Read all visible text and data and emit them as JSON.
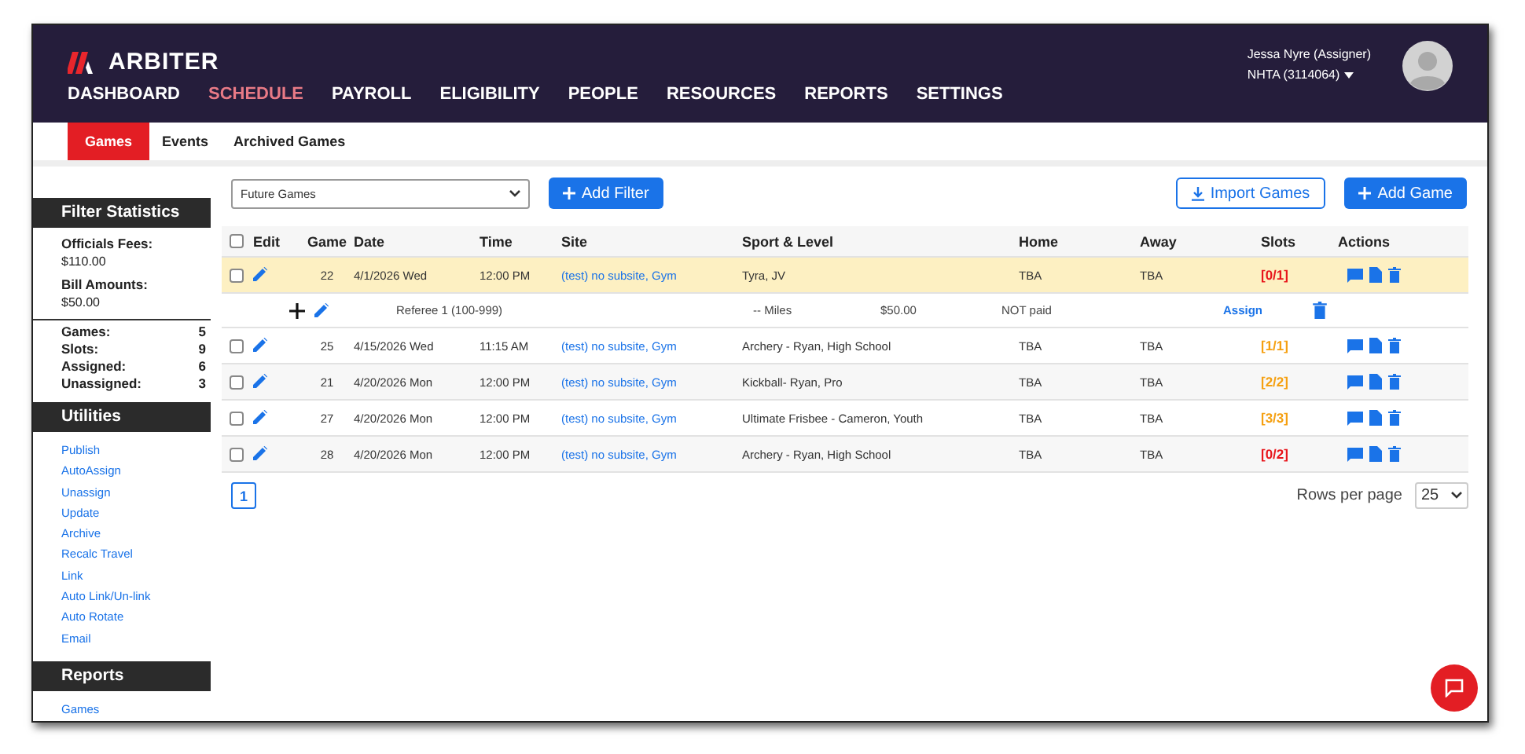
{
  "header": {
    "logo": "ARBITER",
    "nav": [
      {
        "label": "DASHBOARD",
        "selected": false
      },
      {
        "label": "SCHEDULE",
        "selected": true
      },
      {
        "label": "PAYROLL",
        "selected": false
      },
      {
        "label": "ELIGIBILITY",
        "selected": false
      },
      {
        "label": "PEOPLE",
        "selected": false
      },
      {
        "label": "RESOURCES",
        "selected": false
      },
      {
        "label": "REPORTS",
        "selected": false
      },
      {
        "label": "SETTINGS",
        "selected": false
      }
    ],
    "user": "Jessa Nyre (Assigner)",
    "org": "NHTA (3114064)"
  },
  "subtabs": [
    {
      "label": "Games",
      "selected": true
    },
    {
      "label": "Events",
      "selected": false
    },
    {
      "label": "Archived Games",
      "selected": false
    }
  ],
  "sidebar": {
    "filter_title": "Filter Statistics",
    "amounts": [
      {
        "label": "Officials Fees:",
        "value": "$110.00"
      },
      {
        "label": "Bill Amounts:",
        "value": "$50.00"
      }
    ],
    "counts": [
      {
        "label": "Games:",
        "value": "5"
      },
      {
        "label": "Slots:",
        "value": "9"
      },
      {
        "label": "Assigned:",
        "value": "6"
      },
      {
        "label": "Unassigned:",
        "value": "3"
      }
    ],
    "utilities_title": "Utilities",
    "utilities": [
      "Publish",
      "AutoAssign",
      "Unassign",
      "Update",
      "Archive",
      "Recalc Travel",
      "Link",
      "Auto Link/Un-link",
      "Auto Rotate",
      "Email"
    ],
    "reports_title": "Reports",
    "reports": [
      "Games"
    ]
  },
  "toolbar": {
    "filter_select": "Future Games",
    "add_filter": "Add Filter",
    "import": "Import Games",
    "add_game": "Add Game"
  },
  "table": {
    "select_all_checked": false,
    "columns": [
      "Edit",
      "Game",
      "Date",
      "Time",
      "Site",
      "Sport & Level",
      "Home",
      "Away",
      "Slots",
      "Actions"
    ],
    "rows": [
      {
        "selected": true,
        "checked": false,
        "game": "22",
        "date": "4/1/2026 Wed",
        "time": "12:00 PM",
        "site": "(test) no subsite, Gym",
        "sport": "Tyra, JV",
        "home": "TBA",
        "away": "TBA",
        "slots": "[0/1]",
        "color": "#e8151b",
        "assignment": {
          "position": "Referee 1 (100-999)",
          "miles": "-- Miles",
          "fee": "$50.00",
          "paid": "NOT paid",
          "action": "Assign"
        }
      },
      {
        "selected": false,
        "checked": false,
        "game": "25",
        "date": "4/15/2026 Wed",
        "time": "11:15 AM",
        "site": "(test) no subsite, Gym",
        "sport": "Archery - Ryan, High School",
        "home": "TBA",
        "away": "TBA",
        "slots": "[1/1]",
        "color": "#f5a011"
      },
      {
        "selected": false,
        "checked": false,
        "game": "21",
        "date": "4/20/2026 Mon",
        "time": "12:00 PM",
        "site": "(test) no subsite, Gym",
        "sport": "Kickball- Ryan, Pro",
        "home": "TBA",
        "away": "TBA",
        "slots": "[2/2]",
        "color": "#f5a011"
      },
      {
        "selected": false,
        "checked": false,
        "game": "27",
        "date": "4/20/2026 Mon",
        "time": "12:00 PM",
        "site": "(test) no subsite, Gym",
        "sport": "Ultimate Frisbee - Cameron, Youth",
        "home": "TBA",
        "away": "TBA",
        "slots": "[3/3]",
        "color": "#f5a011"
      },
      {
        "selected": false,
        "checked": false,
        "game": "28",
        "date": "4/20/2026 Mon",
        "time": "12:00 PM",
        "site": "(test) no subsite, Gym",
        "sport": "Archery - Ryan, High School",
        "home": "TBA",
        "away": "TBA",
        "slots": "[0/2]",
        "color": "#e8151b"
      }
    ]
  },
  "pagination": {
    "page": "1",
    "rows_label": "Rows per page",
    "rows_value": "25"
  }
}
